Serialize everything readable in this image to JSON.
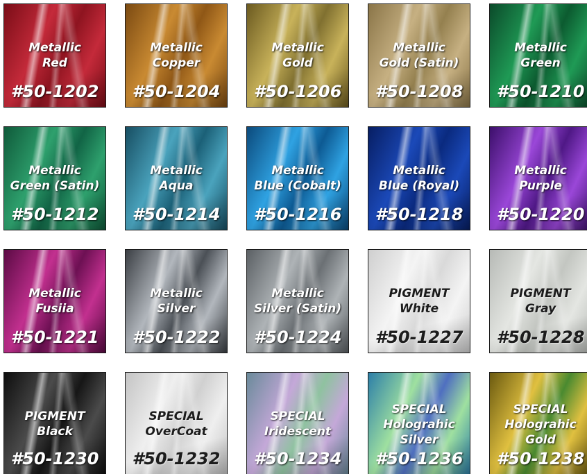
{
  "swatches": [
    {
      "lines": [
        "Metallic",
        "Red"
      ],
      "code": "#50-1202",
      "colors": [
        "#7a0d17",
        "#c42a3a",
        "#8e1420"
      ]
    },
    {
      "lines": [
        "Metallic",
        "Copper"
      ],
      "code": "#50-1204",
      "colors": [
        "#7b4a12",
        "#c98a32",
        "#8f5716"
      ]
    },
    {
      "lines": [
        "Metallic",
        "Gold"
      ],
      "code": "#50-1206",
      "colors": [
        "#6b5a20",
        "#c8b25a",
        "#807030"
      ]
    },
    {
      "lines": [
        "Metallic",
        "Gold (Satin)"
      ],
      "code": "#50-1208",
      "colors": [
        "#8a7548",
        "#c6b082",
        "#94804f"
      ]
    },
    {
      "lines": [
        "Metallic",
        "Green"
      ],
      "code": "#50-1210",
      "colors": [
        "#0b4a2a",
        "#1f9a55",
        "#0c5b30"
      ]
    },
    {
      "lines": [
        "Metallic",
        "Green (Satin)"
      ],
      "code": "#50-1212",
      "colors": [
        "#0f5a3a",
        "#2ea06d",
        "#116445"
      ]
    },
    {
      "lines": [
        "Metallic",
        "Aqua"
      ],
      "code": "#50-1214",
      "colors": [
        "#174e62",
        "#4aa3bd",
        "#1b6077"
      ]
    },
    {
      "lines": [
        "Metallic",
        "Blue (Cobalt)"
      ],
      "code": "#50-1216",
      "colors": [
        "#0b4a7c",
        "#2fa2e2",
        "#0d5a93"
      ]
    },
    {
      "lines": [
        "Metallic",
        "Blue (Royal)"
      ],
      "code": "#50-1218",
      "colors": [
        "#071e63",
        "#1b49b8",
        "#0a2a7f"
      ]
    },
    {
      "lines": [
        "Metallic",
        "Purple"
      ],
      "code": "#50-1220",
      "colors": [
        "#3c0f6b",
        "#9a47d8",
        "#4f1886"
      ]
    },
    {
      "lines": [
        "Metallic",
        "Fusiia"
      ],
      "code": "#50-1221",
      "colors": [
        "#5b0a44",
        "#c2308f",
        "#6d1053"
      ]
    },
    {
      "lines": [
        "Metallic",
        "Silver"
      ],
      "code": "#50-1222",
      "colors": [
        "#3b3f44",
        "#b2b7bd",
        "#4b5056"
      ]
    },
    {
      "lines": [
        "Metallic",
        "Silver (Satin)"
      ],
      "code": "#50-1224",
      "colors": [
        "#5b6064",
        "#aeb3b6",
        "#6b7074"
      ]
    },
    {
      "lines": [
        "PIGMENT",
        "White"
      ],
      "code": "#50-1227",
      "colors": [
        "#cfcfcf",
        "#f4f4f4",
        "#d9d9d9"
      ],
      "dark": true
    },
    {
      "lines": [
        "PIGMENT",
        "Gray"
      ],
      "code": "#50-1228",
      "colors": [
        "#b7bab6",
        "#e4e6e2",
        "#c3c6c1"
      ],
      "dark": true
    },
    {
      "lines": [
        "PIGMENT",
        "Black"
      ],
      "code": "#50-1230",
      "colors": [
        "#0e0e0e",
        "#4b4b4b",
        "#161616"
      ]
    },
    {
      "lines": [
        "SPECIAL",
        "OverCoat"
      ],
      "code": "#50-1232",
      "colors": [
        "#c4c4c4",
        "#efefef",
        "#d0d0d0"
      ],
      "dark": true
    },
    {
      "lines": [
        "SPECIAL",
        "Iridescent"
      ],
      "code": "#50-1234",
      "colors": [
        "#6a8a9a",
        "#c4a8d8",
        "#8fc2a0"
      ]
    },
    {
      "lines": [
        "SPECIAL",
        "Holograhic",
        "Silver"
      ],
      "code": "#50-1236",
      "colors": [
        "#2d7fa8",
        "#9fe0a0",
        "#4f6fc0"
      ]
    },
    {
      "lines": [
        "SPECIAL",
        "Holograhic",
        "Gold"
      ],
      "code": "#50-1238",
      "colors": [
        "#6b5a10",
        "#e0c040",
        "#4a8a30"
      ]
    }
  ]
}
